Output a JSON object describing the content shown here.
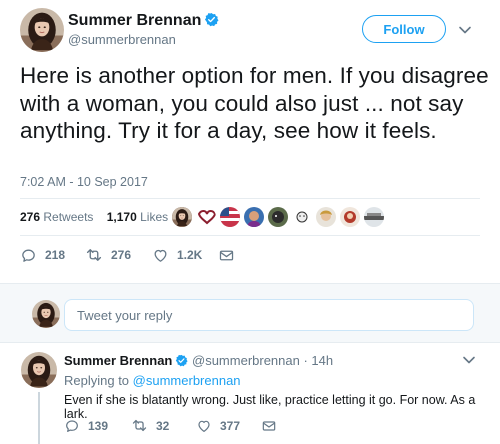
{
  "tweet": {
    "author_name": "Summer Brennan",
    "author_handle": "@summerbrennan",
    "follow_label": "Follow",
    "text": "Here is another option for men. If you disagree with a woman, you could also just ... not say anything. Try it for a day, see how it feels.",
    "timestamp": "7:02 AM - 10 Sep 2017",
    "retweets_count": "276",
    "retweets_label": "Retweets",
    "likes_count": "1,170",
    "likes_label": "Likes",
    "actions": {
      "reply_count": "218",
      "retweet_count": "276",
      "like_count": "1.2K"
    }
  },
  "reply_box": {
    "placeholder": "Tweet your reply"
  },
  "reply": {
    "author_name": "Summer Brennan",
    "author_handle": "@summerbrennan",
    "time": "· 14h",
    "replying_prefix": "Replying to",
    "replying_to": "@summerbrennan",
    "text": "Even if she is blatantly wrong. Just like, practice letting it go. For now. As a lark.",
    "actions": {
      "reply_count": "139",
      "retweet_count": "32",
      "like_count": "377"
    }
  },
  "colors": {
    "brand_blue": "#1da1f2",
    "muted_gray": "#657786",
    "text_dark": "#14171a"
  },
  "icons": [
    "verified-badge-icon",
    "chevron-down-icon",
    "reply-icon",
    "retweet-icon",
    "like-heart-icon",
    "direct-message-icon"
  ]
}
